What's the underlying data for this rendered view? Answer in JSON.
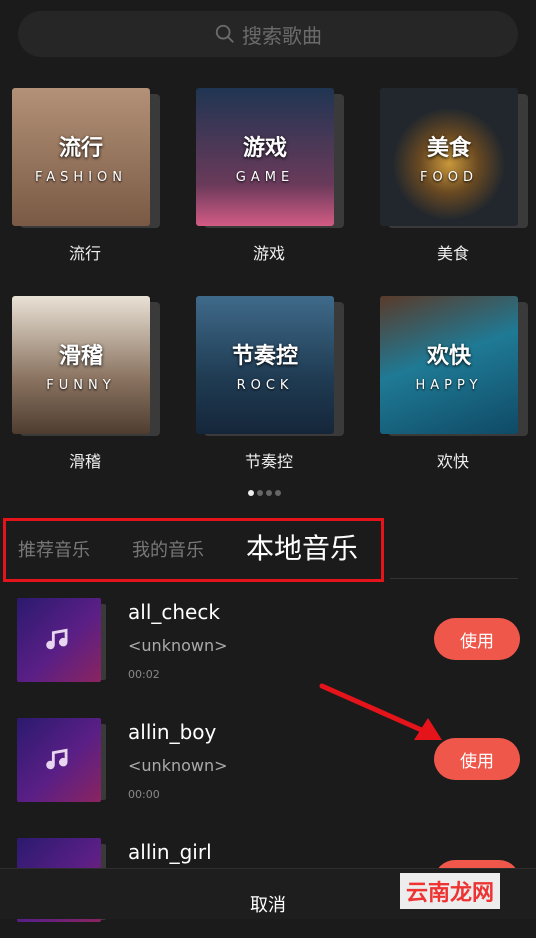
{
  "search": {
    "placeholder": "搜索歌曲"
  },
  "categories": [
    {
      "title": "流行",
      "sub": "FASHION",
      "label": "流行",
      "bg": "#8a6a52"
    },
    {
      "title": "游戏",
      "sub": "GAME",
      "label": "游戏",
      "bg": "#2a3b55"
    },
    {
      "title": "美食",
      "sub": "FOOD",
      "label": "美食",
      "bg": "#2c3036"
    },
    {
      "title": "滑稽",
      "sub": "FUNNY",
      "label": "滑稽",
      "bg": "#7b6553"
    },
    {
      "title": "节奏控",
      "sub": "ROCK",
      "label": "节奏控",
      "bg": "#2b4a66"
    },
    {
      "title": "欢快",
      "sub": "HAPPY",
      "label": "欢快",
      "bg": "#1e5f7a"
    }
  ],
  "pager": {
    "count": 4,
    "active": 0
  },
  "tabs": [
    {
      "label": "推荐音乐"
    },
    {
      "label": "我的音乐"
    },
    {
      "label": "本地音乐"
    }
  ],
  "songs": [
    {
      "name": "all_check",
      "artist": "<unknown>",
      "duration": "00:02",
      "action": "使用"
    },
    {
      "name": "allin_boy",
      "artist": "<unknown>",
      "duration": "00:00",
      "action": "使用"
    },
    {
      "name": "allin_girl",
      "artist": "",
      "duration": "",
      "action": ""
    }
  ],
  "bottom": {
    "cancel": "取消"
  },
  "watermark": "云南龙网",
  "colors": {
    "accent": "#f0574b",
    "highlight_box": "#e5141a"
  }
}
